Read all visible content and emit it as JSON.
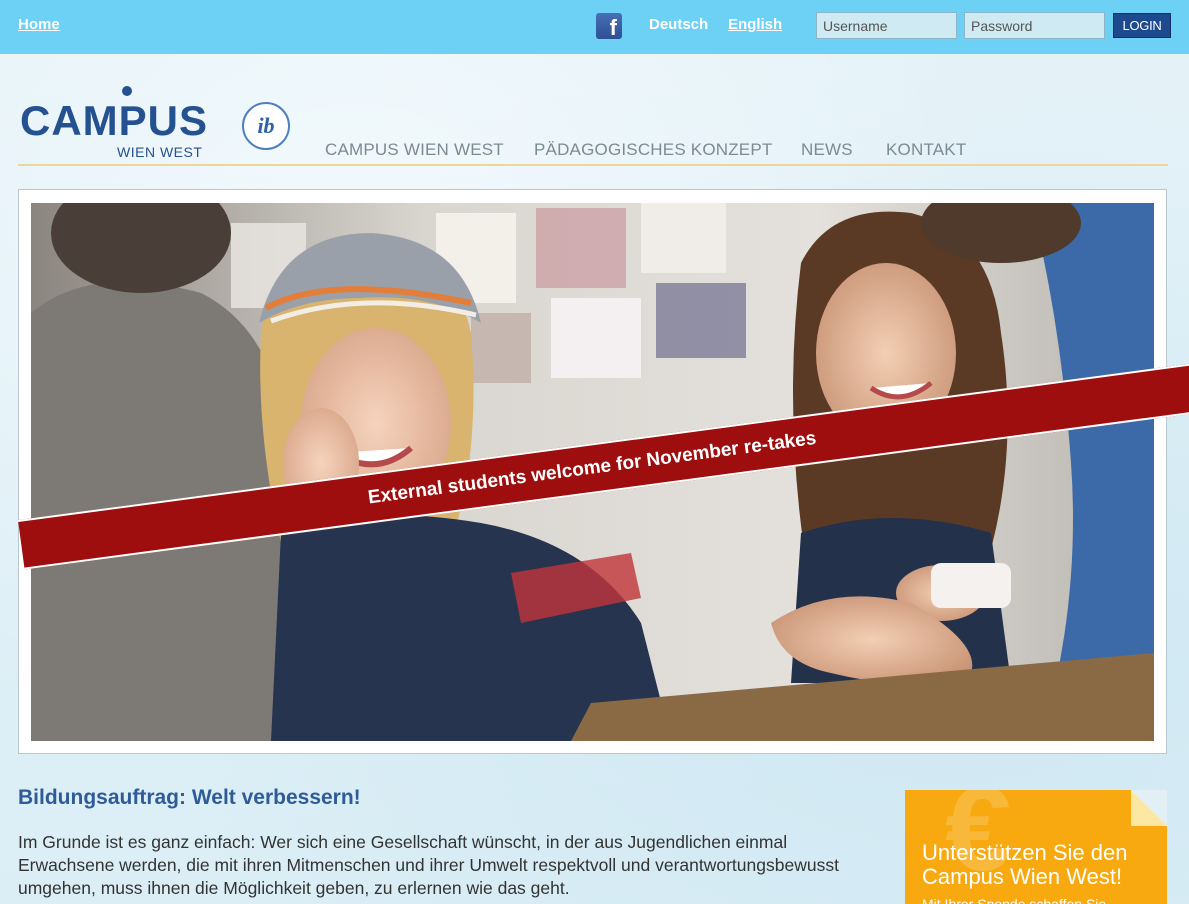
{
  "topbar": {
    "home_label": "Home",
    "facebook_icon": "facebook-icon",
    "lang_de": "Deutsch",
    "lang_en": "English",
    "username_placeholder": "Username",
    "password_placeholder": "Password",
    "login_label": "LOGIN"
  },
  "header": {
    "logo_text": "CAMPUS",
    "logo_sub": "WIEN WEST",
    "ib_logo_text": "ib",
    "nav": [
      {
        "label": "CAMPUS WIEN WEST"
      },
      {
        "label": "PÄDAGOGISCHES KONZEPT"
      },
      {
        "label": "NEWS"
      },
      {
        "label": "KONTAKT"
      }
    ]
  },
  "hero": {
    "banner_text": "External students welcome for November re-takes"
  },
  "content": {
    "title": "Bildungsauftrag: Welt verbessern!",
    "text": "Im Grunde ist es ganz einfach: Wer sich eine Gesellschaft wünscht, in der aus Jugendlichen einmal Erwachsene werden, die mit ihren Mitmenschen und ihrer Umwelt respektvoll und verantwortungsbewusst umgehen, muss ihnen die Möglichkeit geben, zu erlernen wie das geht."
  },
  "donate": {
    "title": "Unterstützen Sie den Campus Wien West!",
    "subtitle": "Mit Ihrer Spende schaffen Sie"
  },
  "colors": {
    "topbar": "#6dd0f5",
    "brand_blue": "#24518f",
    "banner_red": "#9e0e0e",
    "donate_orange": "#f7a90f"
  }
}
